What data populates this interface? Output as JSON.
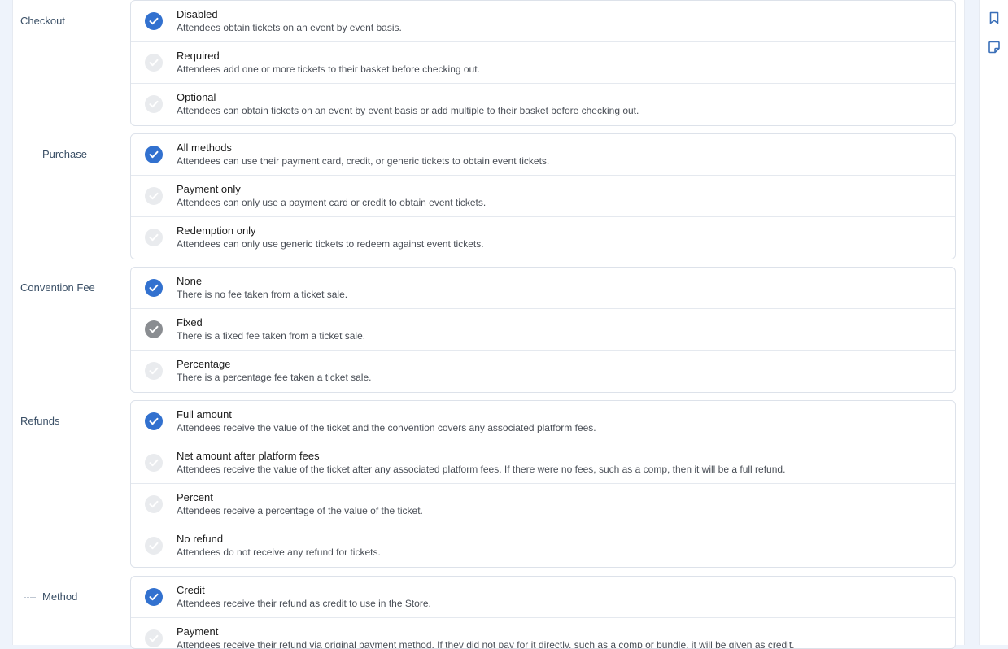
{
  "sections": {
    "checkout": {
      "label": "Checkout",
      "options": [
        {
          "title": "Disabled",
          "desc": "Attendees obtain tickets on an event by event basis."
        },
        {
          "title": "Required",
          "desc": "Attendees add one or more tickets to their basket before checking out."
        },
        {
          "title": "Optional",
          "desc": "Attendees can obtain tickets on an event by event basis or add multiple to their basket before checking out."
        }
      ]
    },
    "purchase": {
      "label": "Purchase",
      "options": [
        {
          "title": "All methods",
          "desc": "Attendees can use their payment card, credit, or generic tickets to obtain event tickets."
        },
        {
          "title": "Payment only",
          "desc": "Attendees can only use a payment card or credit to obtain event tickets."
        },
        {
          "title": "Redemption only",
          "desc": "Attendees can only use generic tickets to redeem against event tickets."
        }
      ]
    },
    "convention_fee": {
      "label": "Convention Fee",
      "options": [
        {
          "title": "None",
          "desc": "There is no fee taken from a ticket sale."
        },
        {
          "title": "Fixed",
          "desc": "There is a fixed fee taken from a ticket sale."
        },
        {
          "title": "Percentage",
          "desc": "There is a percentage fee taken a ticket sale."
        }
      ]
    },
    "refunds": {
      "label": "Refunds",
      "options": [
        {
          "title": "Full amount",
          "desc": "Attendees receive the value of the ticket and the convention covers any associated platform fees."
        },
        {
          "title": "Net amount after platform fees",
          "desc": "Attendees receive the value of the ticket after any associated platform fees. If there were no fees, such as a comp, then it will be a full refund."
        },
        {
          "title": "Percent",
          "desc": "Attendees receive a percentage of the value of the ticket."
        },
        {
          "title": "No refund",
          "desc": "Attendees do not receive any refund for tickets."
        }
      ]
    },
    "method": {
      "label": "Method",
      "options": [
        {
          "title": "Credit",
          "desc": "Attendees receive their refund as credit to use in the Store."
        },
        {
          "title": "Payment",
          "desc": "Attendees receive their refund via original payment method. If they did not pay for it directly, such as a comp or bundle, it will be given as credit."
        }
      ]
    }
  },
  "colors": {
    "selected": "#3271cf",
    "hover": "#8a8d91",
    "unselected": "#e9ebee"
  },
  "rail_icons": [
    "bookmark-icon",
    "note-icon"
  ]
}
